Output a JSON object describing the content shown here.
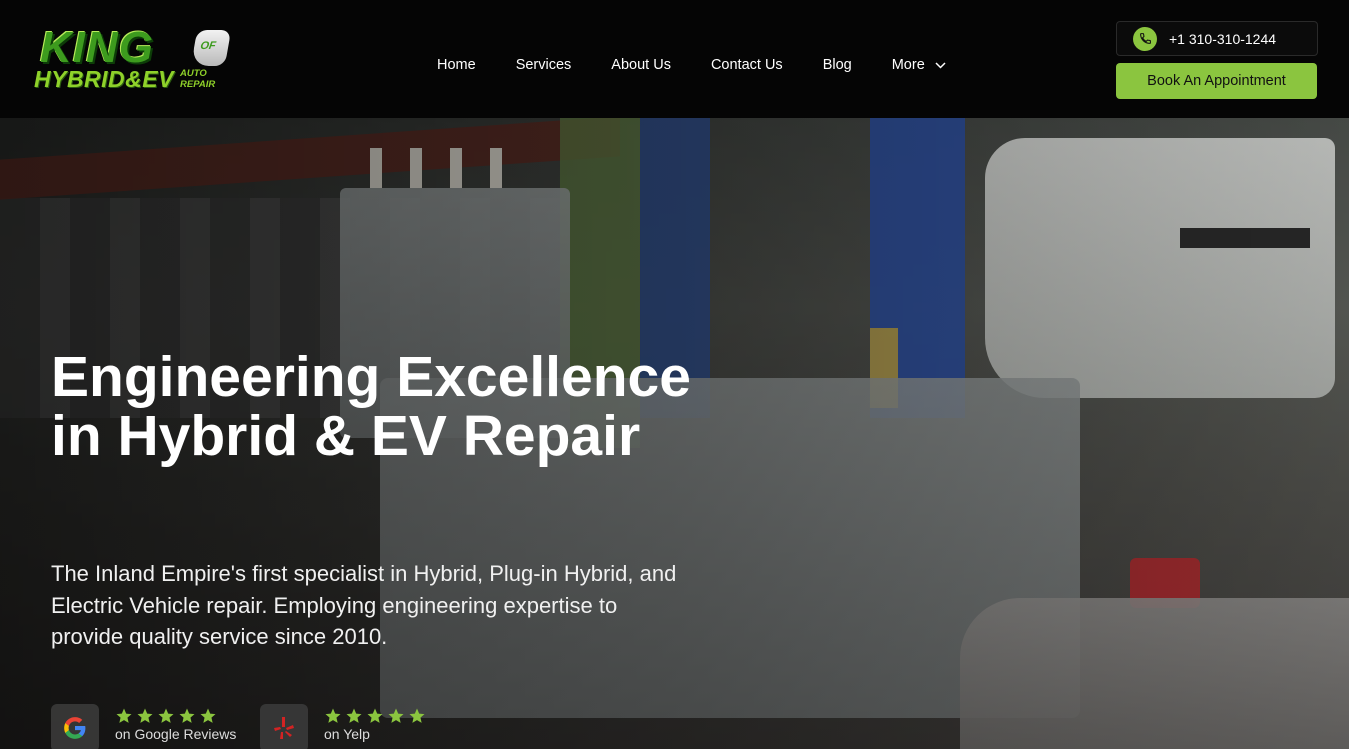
{
  "header": {
    "logo": {
      "line1": "KING",
      "badge": "OF",
      "line2": "HYBRID&EV",
      "line3a": "AUTO",
      "line3b": "REPAIR"
    },
    "nav": [
      "Home",
      "Services",
      "About Us",
      "Contact Us",
      "Blog",
      "More"
    ],
    "phone": "+1 310-310-1244",
    "cta": "Book An Appointment"
  },
  "hero": {
    "title": "Engineering Excellence in Hybrid & EV Repair",
    "subtitle": "The Inland Empire's first specialist in Hybrid, Plug-in Hybrid, and Electric Vehicle repair. Employing engineering expertise to provide quality service since 2010.",
    "reviews": [
      {
        "icon": "google-icon",
        "stars": 5,
        "label": "on Google Reviews"
      },
      {
        "icon": "yelp-icon",
        "stars": 5,
        "label": "on Yelp"
      }
    ]
  },
  "colors": {
    "accent": "#8bc53f",
    "header_bg": "#050505"
  }
}
